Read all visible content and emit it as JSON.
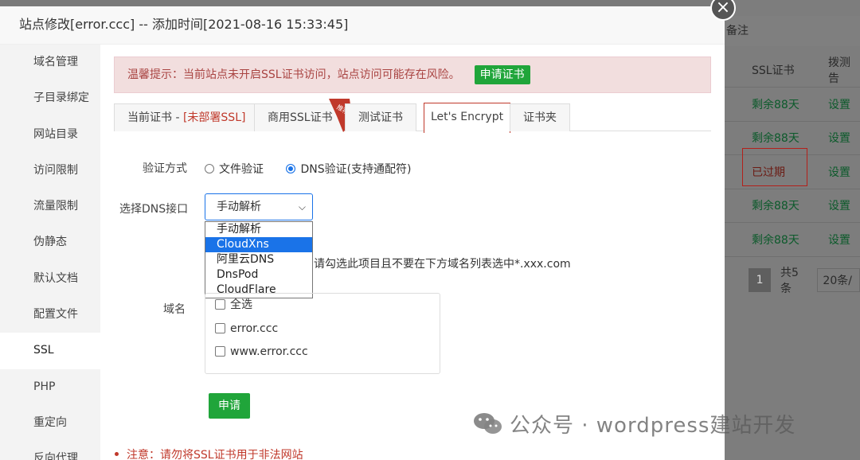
{
  "modal": {
    "title": "站点修改[error.ccc] -- 添加时间[2021-08-16 15:33:45]",
    "close_symbol": "×"
  },
  "sidebar": {
    "items": [
      {
        "label": "域名管理"
      },
      {
        "label": "子目录绑定"
      },
      {
        "label": "网站目录"
      },
      {
        "label": "访问限制"
      },
      {
        "label": "流量限制"
      },
      {
        "label": "伪静态"
      },
      {
        "label": "默认文档"
      },
      {
        "label": "配置文件"
      },
      {
        "label": "SSL",
        "active": true
      },
      {
        "label": "PHP"
      },
      {
        "label": "重定向"
      },
      {
        "label": "反向代理"
      }
    ]
  },
  "alert": {
    "text": "温馨提示：当前站点未开启SSL证书访问，站点访问可能存在风险。",
    "button": "申请证书"
  },
  "tabs": {
    "current_prefix": "当前证书 - ",
    "current_status": "[未部署SSL]",
    "commercial": "商用SSL证书",
    "ribbon": "推荐",
    "test": "测试证书",
    "letsencrypt": "Let's Encrypt",
    "folder": "证书夹"
  },
  "verify": {
    "label": "验证方式",
    "file_option": "文件验证",
    "dns_option": "DNS验证(支持通配符)",
    "selected": "dns"
  },
  "dns": {
    "label": "选择DNS接口",
    "selected_value": "手动解析",
    "options": [
      "手动解析",
      "CloudXns",
      "阿里云DNS",
      "DnsPod",
      "CloudFlare"
    ],
    "highlighted": "CloudXns"
  },
  "hint": "请勾选此项目且不要在下方域名列表选中*.xxx.com",
  "domains": {
    "label": "域名",
    "items": [
      "全选",
      "error.ccc",
      "www.error.ccc"
    ]
  },
  "apply_button": "申请",
  "note": "注意：请勿将SSL证书用于非法网站",
  "background": {
    "header_text": "备注",
    "col_ssl": "SSL证书",
    "col_probe": "拨测告",
    "rows": [
      {
        "ssl": "剩余88天",
        "action": "设置"
      },
      {
        "ssl": "剩余88天",
        "action": "设置"
      },
      {
        "ssl": "已过期",
        "action": "设置"
      },
      {
        "ssl": "剩余88天",
        "action": "设置"
      },
      {
        "ssl": "剩余88天",
        "action": "设置"
      }
    ],
    "pager_page": "1",
    "pager_total": "共5条",
    "pager_size": "20条/"
  },
  "watermark": "公众号 · wordpress建站开发",
  "colors": {
    "accent_green": "#20a53a",
    "alert_red": "#a94442",
    "select_blue": "#1a73e8",
    "highlight_red": "#c0392b"
  }
}
